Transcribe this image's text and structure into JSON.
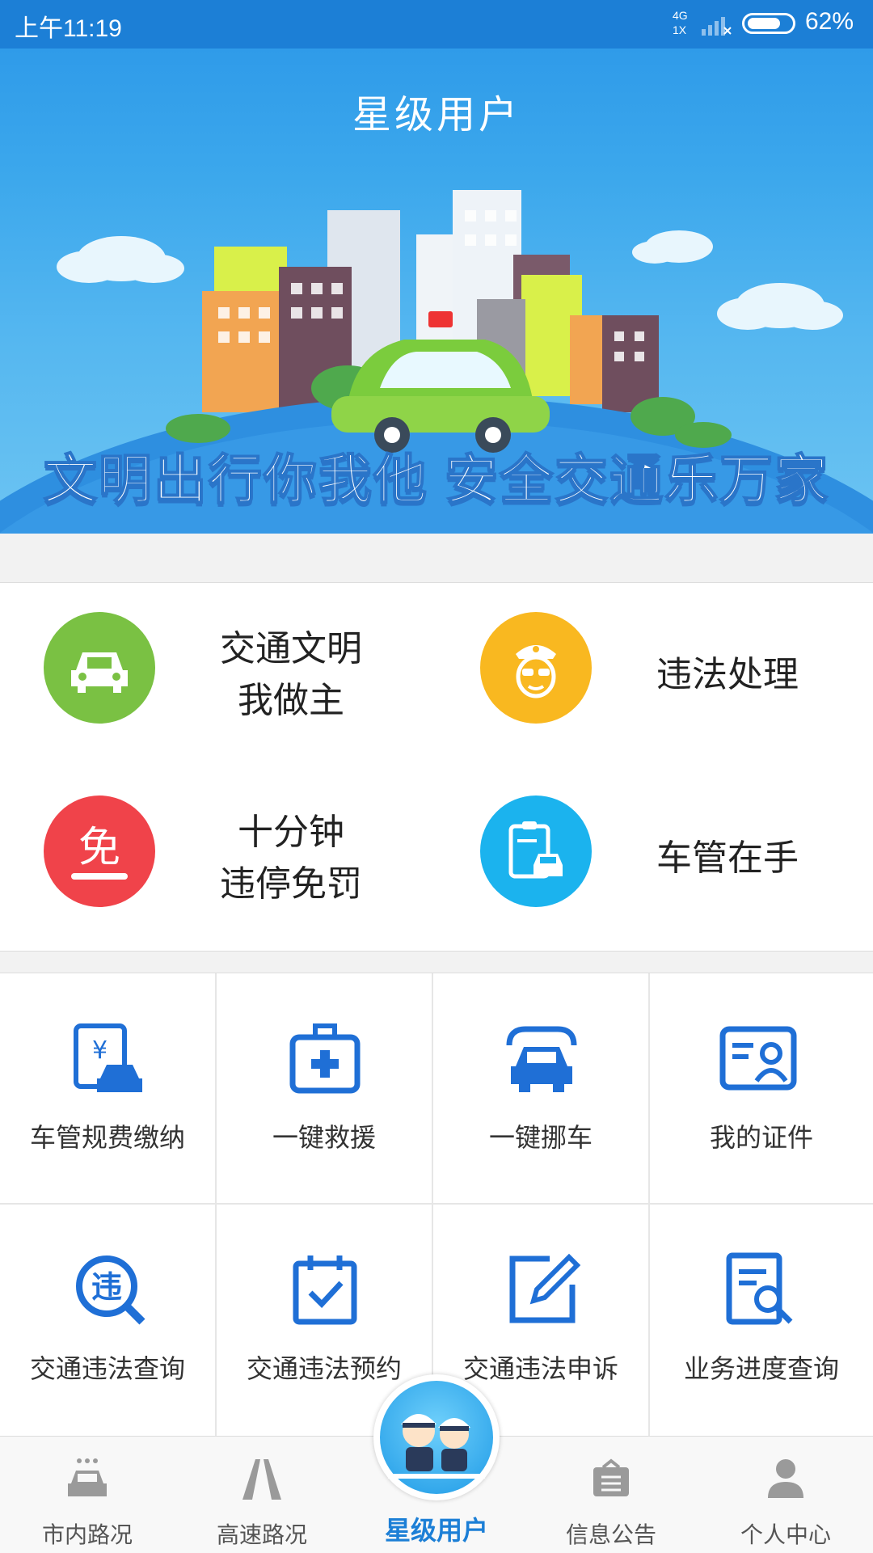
{
  "status_bar": {
    "time": "上午11:19",
    "network": "4G\n1X",
    "battery": "62%"
  },
  "header": {
    "title": "星级用户"
  },
  "banner": {
    "slogan": "文明出行你我他  安全交通乐万家"
  },
  "quick_actions": [
    {
      "label": "交通文明\n我做主",
      "icon": "car-icon",
      "color": "#7ac143"
    },
    {
      "label": "违法处理",
      "icon": "police-icon",
      "color": "#f9b820"
    },
    {
      "label": "十分钟\n违停免罚",
      "icon": "exempt-icon",
      "color": "#f0434a"
    },
    {
      "label": "车管在手",
      "icon": "clipboard-car-icon",
      "color": "#1bb3ee"
    }
  ],
  "services": [
    {
      "label": "车管规费缴纳",
      "icon": "fee-car-icon"
    },
    {
      "label": "一键救援",
      "icon": "first-aid-icon"
    },
    {
      "label": "一键挪车",
      "icon": "tow-car-icon"
    },
    {
      "label": "我的证件",
      "icon": "id-card-icon"
    },
    {
      "label": "交通违法查询",
      "icon": "violation-search-icon"
    },
    {
      "label": "交通违法预约",
      "icon": "calendar-check-icon"
    },
    {
      "label": "交通违法申诉",
      "icon": "edit-icon"
    },
    {
      "label": "业务进度查询",
      "icon": "document-search-icon"
    }
  ],
  "tabbar": {
    "items": [
      {
        "label": "市内路况",
        "icon": "city-car-icon"
      },
      {
        "label": "高速路况",
        "icon": "highway-icon"
      },
      {
        "label": "信息公告",
        "icon": "notice-bag-icon"
      },
      {
        "label": "个人中心",
        "icon": "person-icon"
      }
    ],
    "center_label": "星级用户"
  },
  "colors": {
    "accent": "#1c7fd6",
    "icon_blue": "#1f6fd6"
  }
}
